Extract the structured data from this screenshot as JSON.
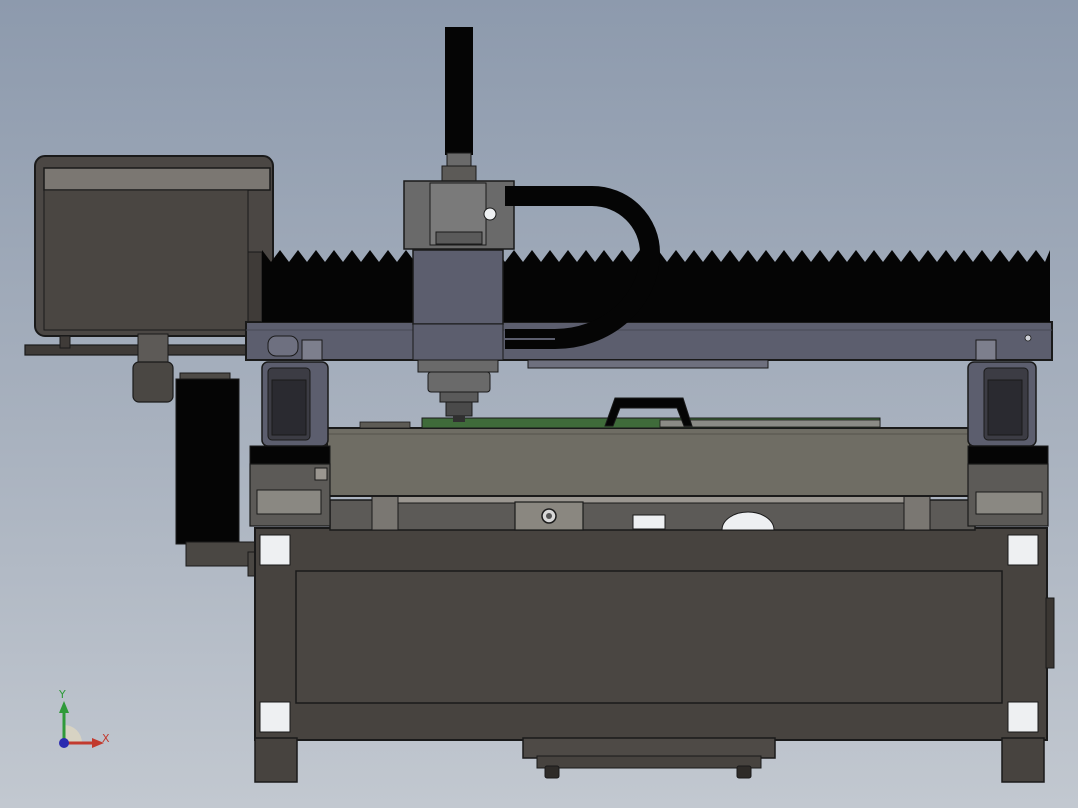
{
  "viewport": {
    "background_top": "#8d9aad",
    "background_bottom": "#c2c8d0"
  },
  "model": {
    "body_color": "#47433f",
    "panel_color": "#53504c",
    "steel_color": "#5c5e6e",
    "carriage_color": "#6a6a6a",
    "table_color": "#6f6d64",
    "black_color": "#050505",
    "pcb_color": "#3f6b3a",
    "outline_color": "#1a1a1a"
  },
  "triad": {
    "y_label": "Y",
    "x_label": "X",
    "y_color": "#2f9a3a",
    "x_color": "#c23a2e",
    "z_color": "#2a2ab0"
  }
}
